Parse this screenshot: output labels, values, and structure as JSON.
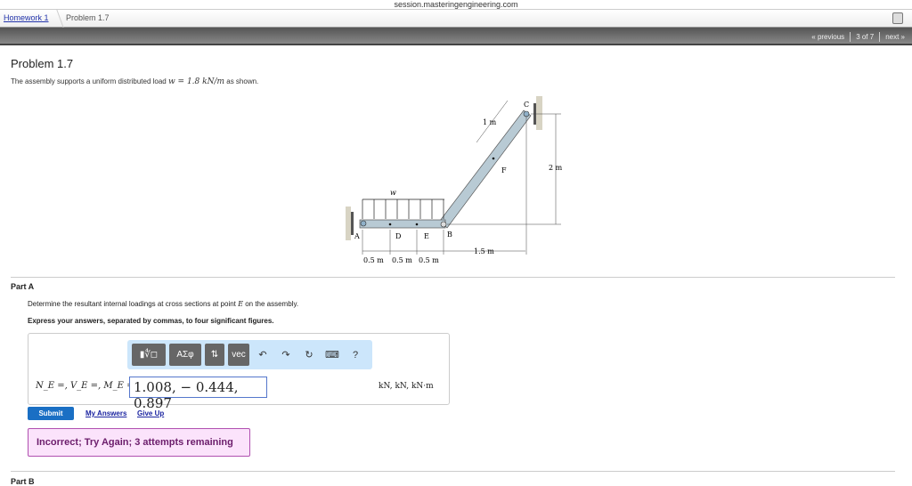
{
  "browser": {
    "url": "session.masteringengineering.com"
  },
  "breadcrumb": {
    "homework": "Homework 1",
    "problem": "Problem 1.7"
  },
  "nav": {
    "previous": "« previous",
    "position": "3 of 7",
    "next": "next »"
  },
  "problem": {
    "title": "Problem 1.7",
    "description_pre": "The assembly supports a uniform distributed load ",
    "description_math": "w = 1.8 kN/m",
    "description_post": " as shown."
  },
  "figure": {
    "labels": {
      "A": "A",
      "B": "B",
      "C": "C",
      "D": "D",
      "E": "E",
      "F": "F",
      "w": "w"
    },
    "dims": {
      "ad": "0.5 m",
      "de": "0.5 m",
      "eb": "0.5 m",
      "bc_h": "1.5 m",
      "bc_v": "2 m",
      "cf": "1 m"
    }
  },
  "partA": {
    "label": "Part A",
    "question_pre": "Determine the resultant internal loadings at cross sections at point ",
    "question_math": "E",
    "question_post": " on the assembly.",
    "instruction": "Express your answers, separated by commas, to four significant figures.",
    "toolbar": {
      "templates": "▮∜◻",
      "greek": "ΑΣφ",
      "arrows": "⇅",
      "vec": "vec",
      "undo": "↶",
      "redo": "↷",
      "reset": "↻",
      "keyboard": "⌨",
      "help": "?"
    },
    "lhs": "N_E =, V_E =, M_E =",
    "answer": "1.008, − 0.444, 0.897",
    "units": "kN, kN, kN·m",
    "submit": "Submit",
    "my_answers": "My Answers",
    "give_up": "Give Up",
    "feedback": "Incorrect; Try Again; 3 attempts remaining"
  },
  "partB": {
    "label": "Part B"
  }
}
